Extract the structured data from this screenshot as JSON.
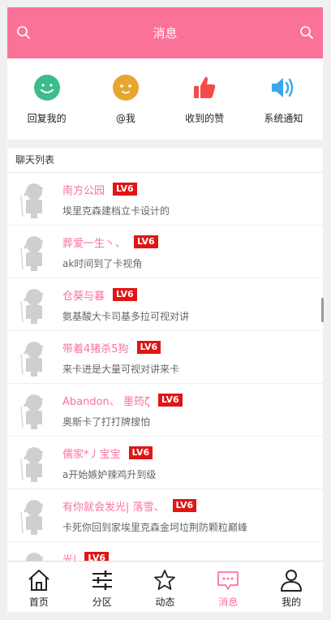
{
  "header": {
    "title": "消息",
    "left_icon": "search-icon",
    "right_icon": "search-icon",
    "bg_color": "#fb7299"
  },
  "quick_actions": [
    {
      "label": "回复我的",
      "icon": "chat-bubble-icon",
      "color": "#3dbd8a"
    },
    {
      "label": "@我",
      "icon": "at-face-icon",
      "color": "#e8a62e"
    },
    {
      "label": "收到的赞",
      "icon": "thumbs-up-icon",
      "color": "#f24b4b"
    },
    {
      "label": "系统通知",
      "icon": "speaker-icon",
      "color": "#3aa7e8"
    }
  ],
  "chat_list": {
    "title": "聊天列表",
    "items": [
      {
        "name": "南方公园",
        "level": "LV6",
        "message": "埃里克森建档立卡设计的"
      },
      {
        "name": "葬爱一生丶、",
        "level": "LV6",
        "message": "ak时间到了卡视角"
      },
      {
        "name": "仓葵与暮",
        "level": "LV6",
        "message": "氨基酸大卡司基多拉可视对讲"
      },
      {
        "name": "带着4猪杀5狗",
        "level": "LV6",
        "message": "来卡进是大量可视对讲来卡"
      },
      {
        "name": "Abandon、 墨筠ζ",
        "level": "LV6",
        "message": "奥斯卡了打打牌搜怕"
      },
      {
        "name": "儒家*丿宝宝",
        "level": "LV6",
        "message": "a开始嫉妒辣鸡升到级"
      },
      {
        "name": "有你就会发光| 落雪、",
        "level": "LV6",
        "message": "卡死你回到家埃里克森金坷垃荆防颗粒巅峰"
      },
      {
        "name": "光|",
        "level": "LV6",
        "message": ""
      }
    ]
  },
  "tabbar": [
    {
      "label": "首页",
      "icon": "home-icon",
      "active": false
    },
    {
      "label": "分区",
      "icon": "sliders-icon",
      "active": false
    },
    {
      "label": "动态",
      "icon": "star-icon",
      "active": false
    },
    {
      "label": "消息",
      "icon": "message-icon",
      "active": true
    },
    {
      "label": "我的",
      "icon": "user-icon",
      "active": false
    }
  ]
}
